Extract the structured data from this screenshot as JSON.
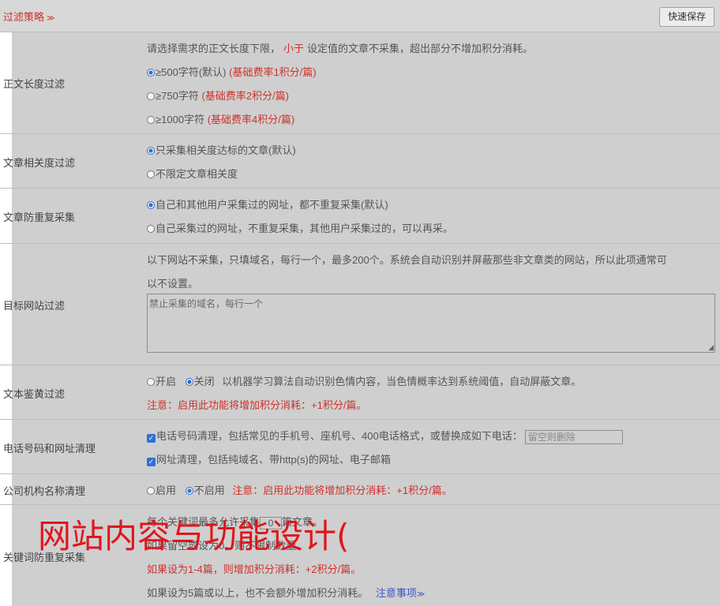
{
  "header": {
    "title": "过滤策略",
    "collapse_icon": "double-chevron-down-icon",
    "quick_save": "快速保存"
  },
  "length_filter": {
    "label": "正文长度过滤",
    "desc_prefix": "请选择需求的正文长度下限，",
    "desc_highlight": "小于",
    "desc_suffix": "设定值的文章不采集，超出部分不增加积分消耗。",
    "options": [
      {
        "text": "≥500字符(默认)",
        "note": "(基础费率1积分/篇)",
        "checked": true
      },
      {
        "text": "≥750字符",
        "note": "(基础费率2积分/篇)",
        "checked": false
      },
      {
        "text": "≥1000字符",
        "note": "(基础费率4积分/篇)",
        "checked": false
      }
    ]
  },
  "relevance": {
    "label": "文章相关度过滤",
    "options": [
      {
        "text": "只采集相关度达标的文章(默认)",
        "checked": true
      },
      {
        "text": "不限定文章相关度",
        "checked": false
      }
    ]
  },
  "dedupe": {
    "label": "文章防重复采集",
    "options": [
      {
        "text": "自己和其他用户采集过的网址，都不重复采集(默认)",
        "checked": true
      },
      {
        "text": "自己采集过的网址，不重复采集，其他用户采集过的，可以再采。",
        "checked": false
      }
    ]
  },
  "site_filter": {
    "label": "目标网站过滤",
    "desc_line1": "以下网站不采集，只填域名，每行一个，最多200个。系统会自动识别并屏蔽那些非文章类的网站，所以此项通常可",
    "desc_line2": "以不设置。",
    "placeholder": "禁止采集的域名，每行一个"
  },
  "porn_filter": {
    "label": "文本鉴黄过滤",
    "on_label": "开启",
    "off_label": "关闭",
    "off_checked": true,
    "desc": "以机器学习算法自动识别色情内容，当色情概率达到系统阈值，自动屏蔽文章。",
    "note": "注意：启用此功能将增加积分消耗：+1积分/篇。"
  },
  "phone_url": {
    "label": "电话号码和网址清理",
    "phone_text": "电话号码清理，包括常见的手机号、座机号、400电话格式，或替换成如下电话：",
    "phone_placeholder": "留空则删除",
    "url_text": "网址清理，包括纯域名、带http(s)的网址、电子邮箱"
  },
  "org_name": {
    "label": "公司机构名称清理",
    "enable_label": "启用",
    "disable_label": "不启用",
    "disable_checked": true,
    "note": "注意：启用此功能将增加积分消耗：+1积分/篇。"
  },
  "keyword_dedupe": {
    "label": "关键词防重复采集",
    "line1_prefix": "每个关键词最多允许采集",
    "line1_value": "0",
    "line1_suffix": "篇文章。",
    "line2": "如果留空或设为0，则不限制数量。",
    "line3": "如果设为1-4篇，则增加积分消耗：+2积分/篇。",
    "line4": "如果设为5篇或以上，也不会额外增加积分消耗。",
    "notes_link": "注意事项",
    "notes_icon": "double-chevron-down-icon"
  },
  "overlay": {
    "text": "网站内容与功能设计("
  }
}
